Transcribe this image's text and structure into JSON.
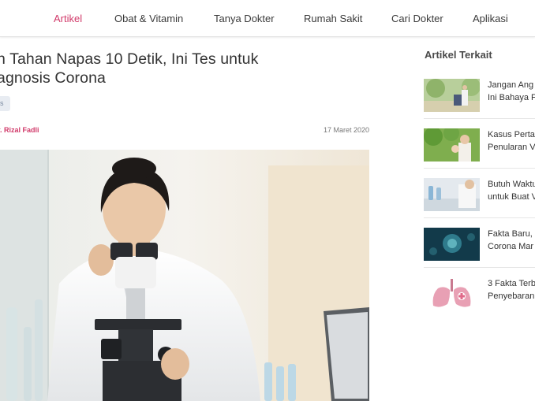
{
  "nav": {
    "items": [
      {
        "label": "Artikel",
        "active": true
      },
      {
        "label": "Obat & Vitamin"
      },
      {
        "label": "Tanya Dokter"
      },
      {
        "label": "Rumah Sakit"
      },
      {
        "label": "Cari Dokter"
      },
      {
        "label": "Aplikasi"
      }
    ],
    "accent_color": "#d13a6a"
  },
  "article": {
    "title_line1": "n Tahan Napas 10 Detik, Ini Tes untuk",
    "title_line2": "agnosis Corona",
    "tag": "s",
    "author": "r. Rizal Fadli",
    "date": "17 Maret 2020"
  },
  "sidebar": {
    "title": "Artikel Terkait",
    "items": [
      {
        "line1": "Jangan Ang",
        "line2": "Ini Bahaya F"
      },
      {
        "line1": "Kasus Perta",
        "line2": "Penularan V"
      },
      {
        "line1": "Butuh Waktu",
        "line2": "untuk Buat V"
      },
      {
        "line1": "Fakta Baru,",
        "line2": "Corona Mar"
      },
      {
        "line1": "3 Fakta Terb",
        "line2": "Penyebaran"
      }
    ]
  }
}
